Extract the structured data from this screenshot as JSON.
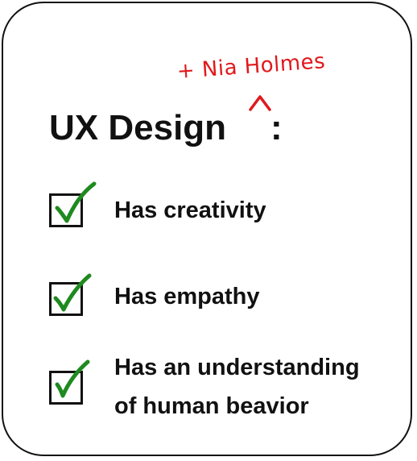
{
  "title": "UX Design",
  "title_suffix": ":",
  "annotation": {
    "text": "+ Nia Holmes",
    "color": "#e0191c"
  },
  "checklist": [
    {
      "label": "Has creativity",
      "checked": true
    },
    {
      "label": "Has empathy",
      "checked": true
    },
    {
      "label_line1": "Has  an understanding",
      "label_line2": "of human beavior",
      "checked": true
    }
  ],
  "colors": {
    "check_mark": "#1f8a1f",
    "text": "#111111",
    "border": "#111111"
  }
}
